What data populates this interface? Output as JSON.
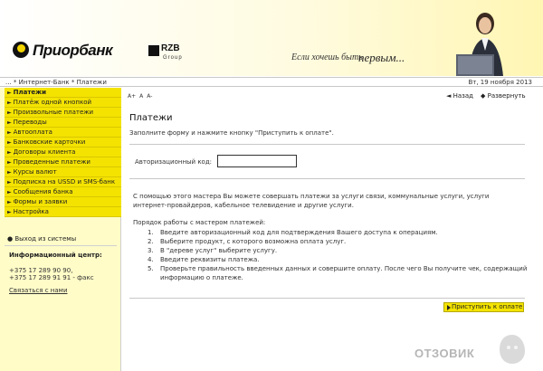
{
  "header": {
    "brand": "Приорбанк",
    "partner": "RZB",
    "partner_sub": "Group",
    "slogan_start": "Если хочешь быть",
    "slogan_end": "первым..."
  },
  "breadcrumb": "... * Интернет-Банк * Платежи",
  "date": "Вт, 19 ноября 2013",
  "sidebar": {
    "items": [
      {
        "label": "Платежи"
      },
      {
        "label": "Платёж одной кнопкой"
      },
      {
        "label": "Произвольные платежи"
      },
      {
        "label": "Переводы"
      },
      {
        "label": "Автооплата"
      },
      {
        "label": "Банковские карточки"
      },
      {
        "label": "Договоры клиента"
      },
      {
        "label": "Проведенные платежи"
      },
      {
        "label": "Курсы валют"
      },
      {
        "label": "Подписка на USSD и SMS-банк"
      },
      {
        "label": "Сообщения банка"
      },
      {
        "label": "Формы и заявки"
      },
      {
        "label": "Настройка"
      }
    ],
    "exit": "Выход из системы",
    "info_title": "Информационный центр:",
    "phone1": "+375 17 289 90 90,",
    "phone2": "+375 17 289 91 91 - факс",
    "contact": "Связаться с нами"
  },
  "main": {
    "font_sizes": [
      "A+",
      "A",
      "A-"
    ],
    "back": "Назад",
    "expand": "Развернуть",
    "title": "Платежи",
    "intro": "Заполните форму и нажмите кнопку \"Приступить к оплате\".",
    "auth_label": "Авторизационный код:",
    "auth_value": "",
    "desc": "С помощью этого мастера Вы можете совершать платежи за услуги связи, коммунальные услуги, услуги интернет-провайдеров, кабельное телевидение и другие услуги.",
    "order_title": "Порядок работы с мастером платежей:",
    "steps": [
      "Введите авторизационный код для подтверждения Вашего доступа к операциям.",
      "Выберите продукт, с которого возможна оплата услуг.",
      "В \"дереве услуг\" выберите услугу.",
      "Введите реквизиты платежа.",
      "Проверьте правильность введенных данных и совершите оплату. После чего Вы получите чек, содержащий информацию о платеже."
    ],
    "pay_button": "Приступить к оплате"
  },
  "watermark": "ОТЗОВИК",
  "colors": {
    "accent": "#f4e300",
    "sidebar_bg": "#fffcc8"
  }
}
